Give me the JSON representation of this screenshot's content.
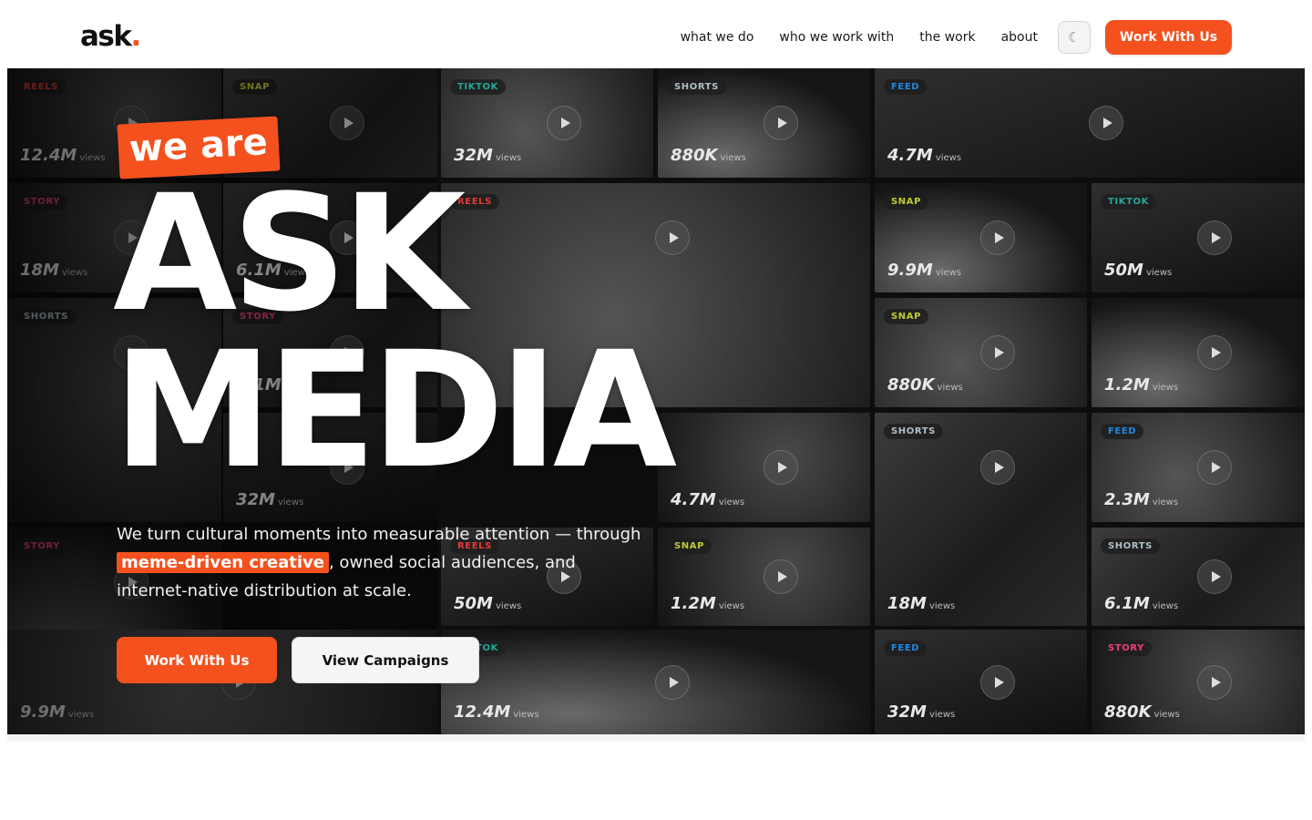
{
  "header": {
    "logo_text": "ask",
    "logo_dot": ".",
    "nav": [
      "what we do",
      "who we work with",
      "the work",
      "about"
    ],
    "theme_icon": "☾",
    "cta": "Work With Us"
  },
  "hero": {
    "tagline": "we are",
    "headline_line1": "ASK",
    "headline_line2": "MEDIA",
    "description_before": "We turn cultural moments into measurable attention — through ",
    "description_highlight": "meme-driven creative",
    "description_after": ", owned social audiences, and internet-native distribution at scale.",
    "primary_button": "Work With Us",
    "secondary_button": "View Campaigns",
    "accent_color": "#f4511e"
  },
  "tiles": [
    {
      "label": "REELS",
      "views": "12.4M",
      "unit": "views",
      "color": "#e53935"
    },
    {
      "label": "SNAP",
      "views": "",
      "unit": "",
      "color": "#c0ca33"
    },
    {
      "label": "TIKTOK",
      "views": "32M",
      "unit": "views",
      "color": "#26a69a"
    },
    {
      "label": "SHORTS",
      "views": "880K",
      "unit": "views",
      "color": "#b0bec5"
    },
    {
      "label": "FEED",
      "views": "4.7M",
      "unit": "views",
      "color": "#1e88e5"
    },
    {
      "label": "STORY",
      "views": "18M",
      "unit": "views",
      "color": "#ec407a"
    },
    {
      "label": "",
      "views": "6.1M",
      "unit": "views",
      "color": "#c0ca33"
    },
    {
      "label": "REELS",
      "views": "",
      "unit": "",
      "color": "#e53935"
    },
    {
      "label": "SNAP",
      "views": "9.9M",
      "unit": "views",
      "color": "#c0ca33"
    },
    {
      "label": "TIKTOK",
      "views": "50M",
      "unit": "views",
      "color": "#26a69a"
    },
    {
      "label": "SHORTS",
      "views": "",
      "unit": "",
      "color": "#b0bec5"
    },
    {
      "label": "STORY",
      "views": "6.1M",
      "unit": "views",
      "color": "#ec407a"
    },
    {
      "label": "SNAP",
      "views": "880K",
      "unit": "views",
      "color": "#c0ca33"
    },
    {
      "label": "",
      "views": "1.2M",
      "unit": "views",
      "color": "#b0bec5"
    },
    {
      "label": "",
      "views": "32M",
      "unit": "views",
      "color": "#b0bec5"
    },
    {
      "label": "",
      "views": "4.7M",
      "unit": "views",
      "color": "#26a69a"
    },
    {
      "label": "SHORTS",
      "views": "18M",
      "unit": "views",
      "color": "#b0bec5"
    },
    {
      "label": "FEED",
      "views": "2.3M",
      "unit": "views",
      "color": "#1e88e5"
    },
    {
      "label": "STORY",
      "views": "",
      "unit": "",
      "color": "#ec407a"
    },
    {
      "label": "REELS",
      "views": "50M",
      "unit": "views",
      "color": "#e53935"
    },
    {
      "label": "SNAP",
      "views": "1.2M",
      "unit": "views",
      "color": "#c0ca33"
    },
    {
      "label": "SHORTS",
      "views": "6.1M",
      "unit": "views",
      "color": "#b0bec5"
    },
    {
      "label": "",
      "views": "9.9M",
      "unit": "views",
      "color": "#b0bec5"
    },
    {
      "label": "TIKTOK",
      "views": "12.4M",
      "unit": "views",
      "color": "#26a69a"
    },
    {
      "label": "FEED",
      "views": "32M",
      "unit": "views",
      "color": "#1e88e5"
    },
    {
      "label": "STORY",
      "views": "880K",
      "unit": "views",
      "color": "#ec407a"
    }
  ]
}
